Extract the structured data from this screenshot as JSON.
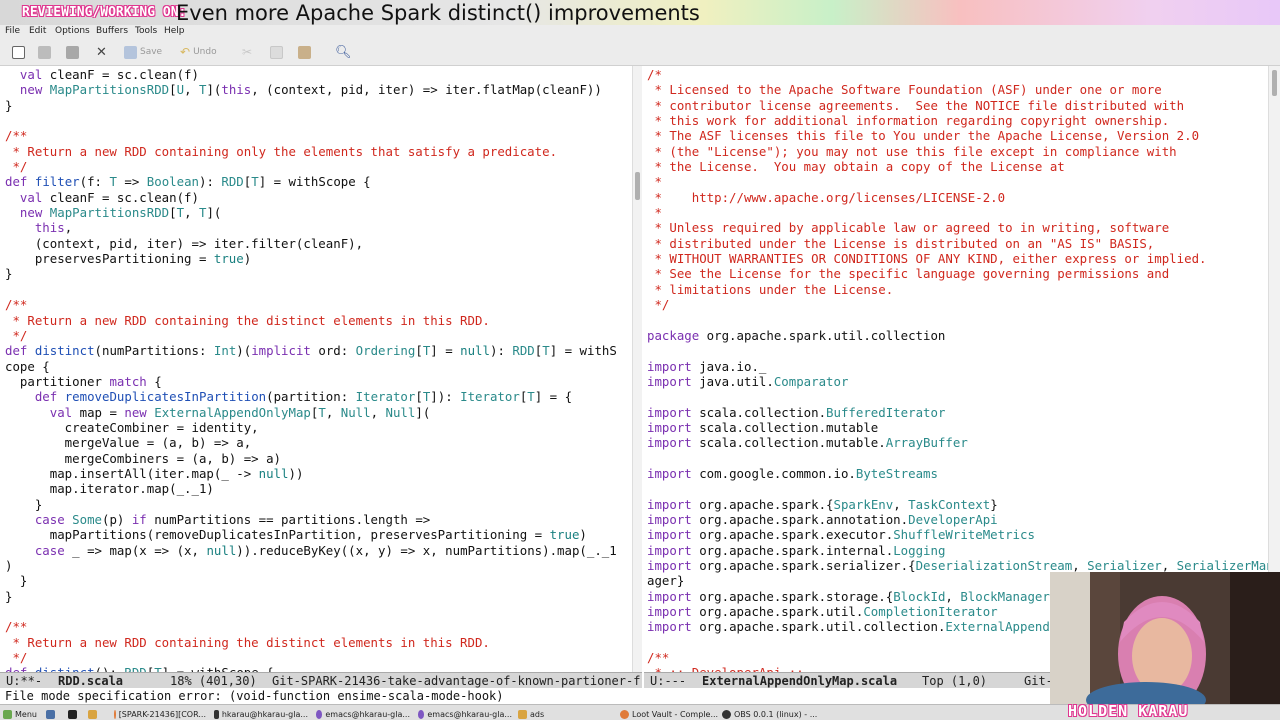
{
  "banner": {
    "label": "REVIEWING/WORKING ON:",
    "title": "Even more Apache Spark distinct() improvements"
  },
  "menu": [
    "File",
    "Edit",
    "Options",
    "Buffers",
    "Tools",
    "Help"
  ],
  "toolbar": {
    "save": "Save",
    "undo": "Undo",
    "icons": [
      "new-file-icon",
      "open-folder-icon",
      "save-file-icon",
      "close-icon",
      "save-icon",
      "undo-icon",
      "cut-icon",
      "copy-icon",
      "paste-icon",
      "search-icon"
    ]
  },
  "left_buffer": {
    "lines": [
      "  val cleanF = sc.clean(f)",
      "  new MapPartitionsRDD[U, T](this, (context, pid, iter) => iter.flatMap(cleanF))",
      "}",
      "",
      "/**",
      " * Return a new RDD containing only the elements that satisfy a predicate.",
      " */",
      "def filter(f: T => Boolean): RDD[T] = withScope {",
      "  val cleanF = sc.clean(f)",
      "  new MapPartitionsRDD[T, T](",
      "    this,",
      "    (context, pid, iter) => iter.filter(cleanF),",
      "    preservesPartitioning = true)",
      "}",
      "",
      "/**",
      " * Return a new RDD containing the distinct elements in this RDD.",
      " */",
      "def distinct(numPartitions: Int)(implicit ord: Ordering[T] = null): RDD[T] = withS",
      "cope {",
      "  partitioner match {",
      "    def removeDuplicatesInPartition(partition: Iterator[T]): Iterator[T] = {",
      "      val map = new ExternalAppendOnlyMap[T, Null, Null](",
      "        createCombiner = identity,",
      "        mergeValue = (a, b) => a,",
      "        mergeCombiners = (a, b) => a)",
      "      map.insertAll(iter.map(_ -> null))",
      "      map.iterator.map(_._1)",
      "    }",
      "    case Some(p) if numPartitions == partitions.length =>",
      "      mapPartitions(removeDuplicatesInPartition, preservesPartitioning = true)",
      "    case _ => map(x => (x, null)).reduceByKey((x, y) => x, numPartitions).map(_._1",
      ")",
      "  }",
      "}",
      "",
      "/**",
      " * Return a new RDD containing the distinct elements in this RDD.",
      " */",
      "def distinct(): RDD[T] = withScope {"
    ]
  },
  "right_buffer": {
    "lines": [
      "/*",
      " * Licensed to the Apache Software Foundation (ASF) under one or more",
      " * contributor license agreements.  See the NOTICE file distributed with",
      " * this work for additional information regarding copyright ownership.",
      " * The ASF licenses this file to You under the Apache License, Version 2.0",
      " * (the \"License\"); you may not use this file except in compliance with",
      " * the License.  You may obtain a copy of the License at",
      " *",
      " *    http://www.apache.org/licenses/LICENSE-2.0",
      " *",
      " * Unless required by applicable law or agreed to in writing, software",
      " * distributed under the License is distributed on an \"AS IS\" BASIS,",
      " * WITHOUT WARRANTIES OR CONDITIONS OF ANY KIND, either express or implied.",
      " * See the License for the specific language governing permissions and",
      " * limitations under the License.",
      " */",
      "",
      "package org.apache.spark.util.collection",
      "",
      "import java.io._",
      "import java.util.Comparator",
      "",
      "import scala.collection.BufferedIterator",
      "import scala.collection.mutable",
      "import scala.collection.mutable.ArrayBuffer",
      "",
      "import com.google.common.io.ByteStreams",
      "",
      "import org.apache.spark.{SparkEnv, TaskContext}",
      "import org.apache.spark.annotation.DeveloperApi",
      "import org.apache.spark.executor.ShuffleWriteMetrics",
      "import org.apache.spark.internal.Logging",
      "import org.apache.spark.serializer.{DeserializationStream, Serializer, SerializerMan",
      "ager}",
      "import org.apache.spark.storage.{BlockId, BlockManager}",
      "import org.apache.spark.util.CompletionIterator",
      "import org.apache.spark.util.collection.ExternalAppendOnlyMap",
      "",
      "/**",
      " * :: DeveloperApi ::"
    ]
  },
  "modeline_left": {
    "state": "U:**-",
    "buffer": "RDD.scala",
    "position": "18% (401,30)",
    "vc": "Git-SPARK-21436-take-advantage-of-known-partioner-f"
  },
  "modeline_right": {
    "state": "U:---",
    "buffer": "ExternalAppendOnlyMap.scala",
    "position": "Top (1,0)",
    "vc": "Git-"
  },
  "echo_area": "File mode specification error: (void-function ensime-scala-mode-hook)",
  "taskbar": {
    "items": [
      "Menu",
      "[SPARK-21436][COR...",
      "hkarau@hkarau-gla...",
      "emacs@hkarau-gla...",
      "emacs@hkarau-gla...",
      "ads",
      "Loot Vault - Comple...",
      "OBS 0.0.1 (linux) - ..."
    ]
  },
  "webcam": {
    "name": "HOLDEN KARAU"
  },
  "colors": {
    "keyword": "#7a2fb0",
    "type": "#2a8a8a",
    "function": "#1f4fb5",
    "comment": "#d0281e",
    "banner_outline": "#e0358f"
  }
}
